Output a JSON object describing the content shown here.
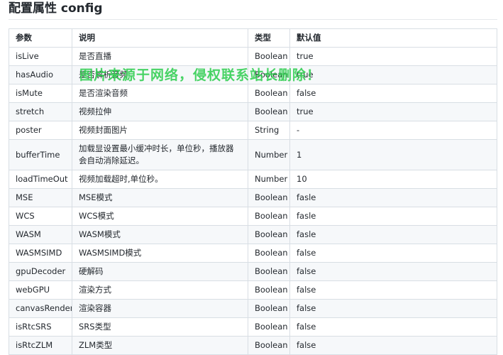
{
  "heading": "配置属性 config",
  "watermark": "图片来源于网络，侵权联系站长删除！",
  "table": {
    "headers": [
      "参数",
      "说明",
      "类型",
      "默认值"
    ],
    "rows": [
      [
        "isLive",
        "是否直播",
        "Boolean",
        "true"
      ],
      [
        "hasAudio",
        "是否解析音频",
        "Boolean",
        "true"
      ],
      [
        "isMute",
        "是否渲染音频",
        "Boolean",
        "false"
      ],
      [
        "stretch",
        "视频拉伸",
        "Boolean",
        "true"
      ],
      [
        "poster",
        "视频封面图片",
        "String",
        "-"
      ],
      [
        "bufferTime",
        "加载显设置最小缓冲时长，单位秒，播放器会自动消除延迟。",
        "Number",
        "1"
      ],
      [
        "loadTimeOut",
        "视频加载超时,单位秒。",
        "Number",
        "10"
      ],
      [
        "MSE",
        "MSE模式",
        "Boolean",
        "fasle"
      ],
      [
        "WCS",
        "WCS模式",
        "Boolean",
        "fasle"
      ],
      [
        "WASM",
        "WASM模式",
        "Boolean",
        "fasle"
      ],
      [
        "WASMSIMD",
        "WASMSIMD模式",
        "Boolean",
        "false"
      ],
      [
        "gpuDecoder",
        "硬解码",
        "Boolean",
        "false"
      ],
      [
        "webGPU",
        "渲染方式",
        "Boolean",
        "false"
      ],
      [
        "canvasRender",
        "渲染容器",
        "Boolean",
        "false"
      ],
      [
        "isRtcSRS",
        "SRS类型",
        "Boolean",
        "false"
      ],
      [
        "isRtcZLM",
        "ZLM类型",
        "Boolean",
        "false"
      ]
    ]
  }
}
